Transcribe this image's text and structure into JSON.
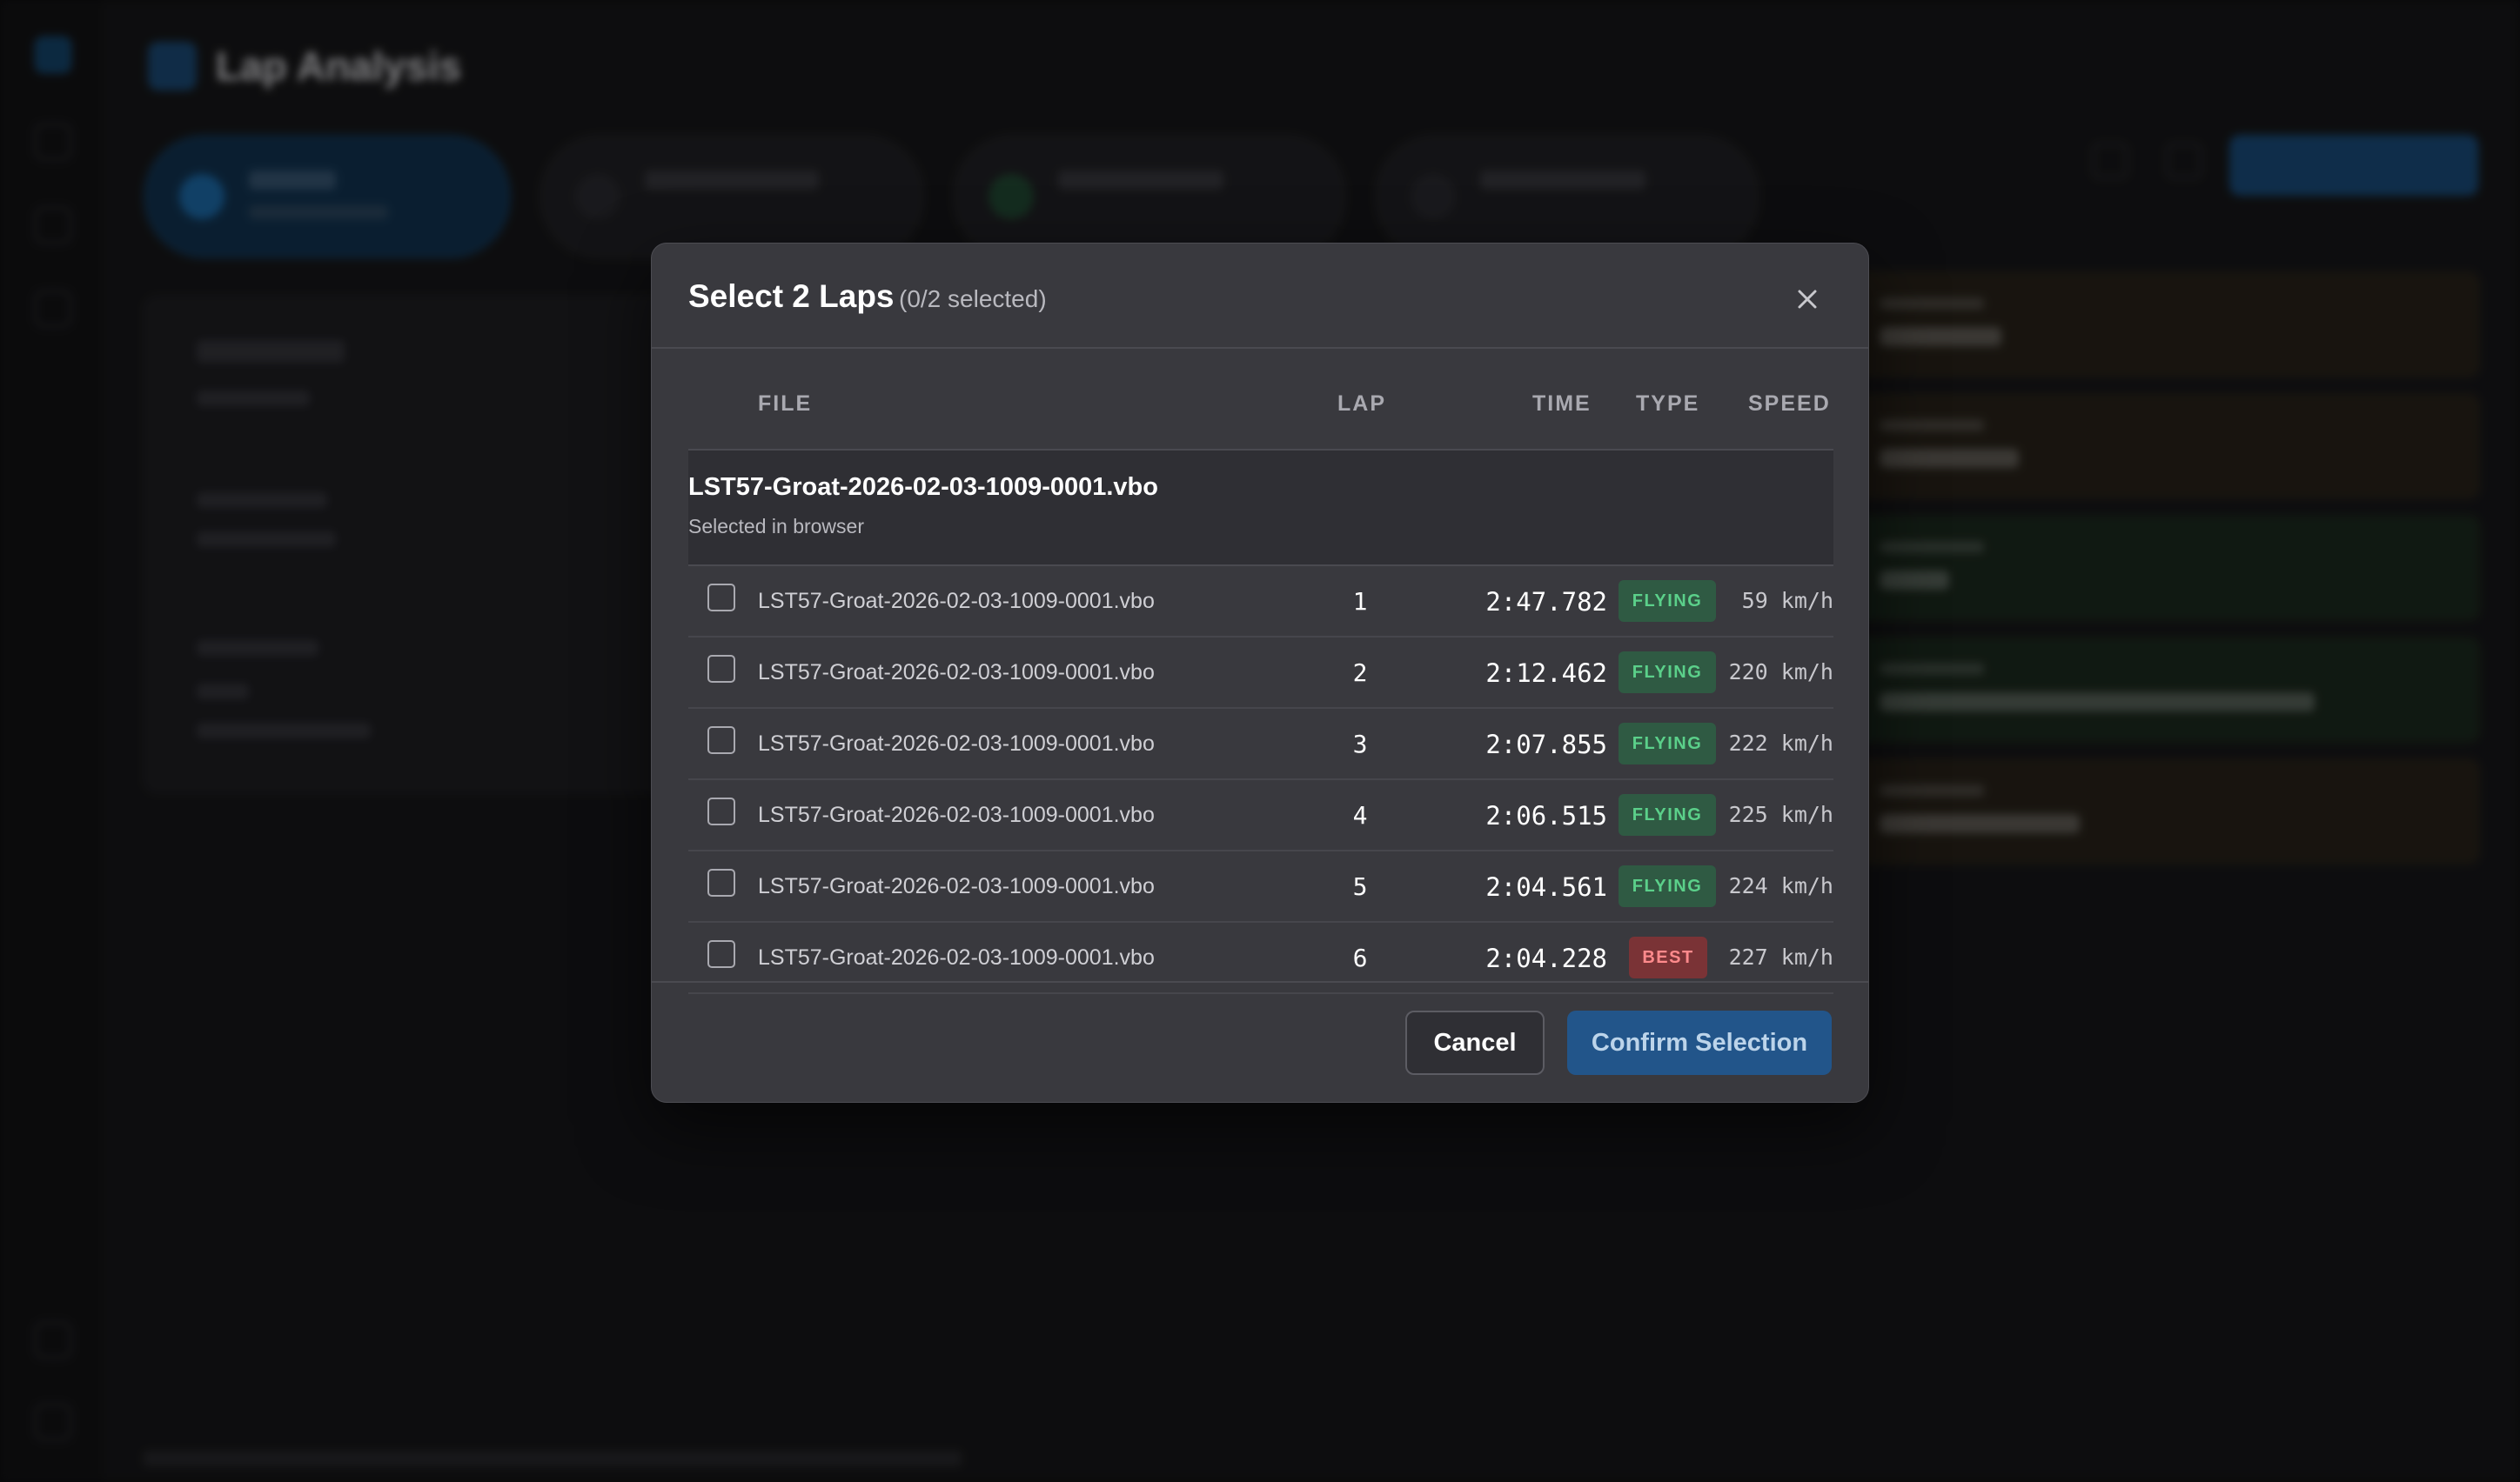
{
  "modal": {
    "title": "Select 2 Laps",
    "selection_count": "(0/2 selected)",
    "columns": {
      "file": "FILE",
      "lap": "LAP",
      "time": "TIME",
      "type": "TYPE",
      "speed": "SPEED"
    },
    "group": {
      "name": "LST57-Groat-2026-02-03-1009-0001.vbo",
      "subtitle": "Selected in browser"
    },
    "rows": [
      {
        "file": "LST57-Groat-2026-02-03-1009-0001.vbo",
        "lap": "1",
        "time": "2:47.782",
        "type": "FLYING",
        "speed": "59 km/h",
        "checked": false
      },
      {
        "file": "LST57-Groat-2026-02-03-1009-0001.vbo",
        "lap": "2",
        "time": "2:12.462",
        "type": "FLYING",
        "speed": "220 km/h",
        "checked": false
      },
      {
        "file": "LST57-Groat-2026-02-03-1009-0001.vbo",
        "lap": "3",
        "time": "2:07.855",
        "type": "FLYING",
        "speed": "222 km/h",
        "checked": false
      },
      {
        "file": "LST57-Groat-2026-02-03-1009-0001.vbo",
        "lap": "4",
        "time": "2:06.515",
        "type": "FLYING",
        "speed": "225 km/h",
        "checked": false
      },
      {
        "file": "LST57-Groat-2026-02-03-1009-0001.vbo",
        "lap": "5",
        "time": "2:04.561",
        "type": "FLYING",
        "speed": "224 km/h",
        "checked": false
      },
      {
        "file": "LST57-Groat-2026-02-03-1009-0001.vbo",
        "lap": "6",
        "time": "2:04.228",
        "type": "BEST",
        "speed": "227 km/h",
        "checked": false
      }
    ],
    "cancel_label": "Cancel",
    "confirm_label": "Confirm Selection",
    "close_icon": "close-icon"
  },
  "background": {
    "app_title": "Lap Analysis"
  },
  "colors": {
    "modal_bg": "#39393e",
    "flying_badge": "#2f5a43",
    "flying_text": "#5bd08a",
    "best_badge": "#7a3336",
    "best_text": "#ff8a8c",
    "confirm_button": "#22558a"
  }
}
